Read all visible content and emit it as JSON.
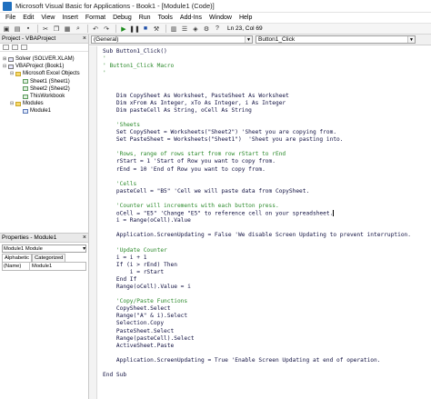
{
  "window": {
    "title": "Microsoft Visual Basic for Applications - Book1 - [Module1 (Code)]"
  },
  "menu": [
    "File",
    "Edit",
    "View",
    "Insert",
    "Format",
    "Debug",
    "Run",
    "Tools",
    "Add-Ins",
    "Window",
    "Help"
  ],
  "toolbar": {
    "status": "Ln 23, Col 69"
  },
  "project_panel": {
    "title": "Project - VBAProject",
    "tree": [
      {
        "label": "Solver (SOLVER.XLAM)",
        "icon": "vba-project-icon",
        "toggle": "+",
        "indent": 0
      },
      {
        "label": "VBAProject (Book1)",
        "icon": "vba-project-icon",
        "toggle": "-",
        "indent": 0
      },
      {
        "label": "Microsoft Excel Objects",
        "icon": "folder-icon",
        "toggle": "-",
        "indent": 1
      },
      {
        "label": "Sheet1 (Sheet1)",
        "icon": "sheet-icon",
        "toggle": "",
        "indent": 2
      },
      {
        "label": "Sheet2 (Sheet2)",
        "icon": "sheet-icon",
        "toggle": "",
        "indent": 2
      },
      {
        "label": "ThisWorkbook",
        "icon": "workbook-icon",
        "toggle": "",
        "indent": 2
      },
      {
        "label": "Modules",
        "icon": "folder-icon",
        "toggle": "-",
        "indent": 1
      },
      {
        "label": "Module1",
        "icon": "module-icon",
        "toggle": "",
        "indent": 2
      }
    ]
  },
  "properties_panel": {
    "title": "Properties - Module1",
    "object_select": "Module1 Module",
    "tabs": [
      "Alphabetic",
      "Categorized"
    ],
    "active_tab": 0,
    "rows": [
      {
        "name": "(Name)",
        "value": "Module1"
      }
    ]
  },
  "code_window": {
    "object_combo": "(General)",
    "procedure_combo": "Button1_Click",
    "lines": [
      {
        "text": "Sub Button1_Click()",
        "kind": "code"
      },
      {
        "text": "'",
        "kind": "comment"
      },
      {
        "text": "' Button1_Click Macro",
        "kind": "comment"
      },
      {
        "text": "'",
        "kind": "comment"
      },
      {
        "text": "",
        "kind": "blank"
      },
      {
        "text": "",
        "kind": "blank"
      },
      {
        "text": "    Dim CopySheet As Worksheet, PasteSheet As Worksheet",
        "kind": "code"
      },
      {
        "text": "    Dim xFrom As Integer, xTo As Integer, i As Integer",
        "kind": "code"
      },
      {
        "text": "    Dim pasteCell As String, oCell As String",
        "kind": "code"
      },
      {
        "text": "",
        "kind": "blank"
      },
      {
        "text": "    'Sheets",
        "kind": "comment"
      },
      {
        "text": "    Set CopySheet = Worksheets(\"Sheet2\") 'Sheet you are copying from.",
        "kind": "code"
      },
      {
        "text": "    Set PasteSheet = Worksheets(\"Sheet1\")  'Sheet you are pasting into.",
        "kind": "code"
      },
      {
        "text": "",
        "kind": "blank"
      },
      {
        "text": "    'Rows, range of rows start from row rStart to rEnd",
        "kind": "comment"
      },
      {
        "text": "    rStart = 1 'Start of Row you want to copy from.",
        "kind": "code"
      },
      {
        "text": "    rEnd = 10 'End of Row you want to copy from.",
        "kind": "code"
      },
      {
        "text": "",
        "kind": "blank"
      },
      {
        "text": "    'Cells",
        "kind": "comment"
      },
      {
        "text": "    pasteCell = \"B5\" 'Cell we will paste data from CopySheet.",
        "kind": "code"
      },
      {
        "text": "",
        "kind": "blank"
      },
      {
        "text": "    'Counter will increments with each button press.",
        "kind": "comment"
      },
      {
        "text": "    oCell = \"E5\" 'Change \"E5\" to reference cell on your spreadsheet.",
        "kind": "code",
        "cursor": true
      },
      {
        "text": "    i = Range(oCell).Value",
        "kind": "code"
      },
      {
        "text": "",
        "kind": "blank"
      },
      {
        "text": "    Application.ScreenUpdating = False 'We disable Screen Updating to prevent interruption.",
        "kind": "code"
      },
      {
        "text": "",
        "kind": "blank"
      },
      {
        "text": "    'Update Counter",
        "kind": "comment"
      },
      {
        "text": "    i = i + 1",
        "kind": "code"
      },
      {
        "text": "    If (i > rEnd) Then",
        "kind": "code"
      },
      {
        "text": "        i = rStart",
        "kind": "code"
      },
      {
        "text": "    End If",
        "kind": "code"
      },
      {
        "text": "    Range(oCell).Value = i",
        "kind": "code"
      },
      {
        "text": "",
        "kind": "blank"
      },
      {
        "text": "    'Copy/Paste Functions",
        "kind": "comment"
      },
      {
        "text": "    CopySheet.Select",
        "kind": "code"
      },
      {
        "text": "    Range(\"A\" & i).Select",
        "kind": "code"
      },
      {
        "text": "    Selection.Copy",
        "kind": "code"
      },
      {
        "text": "    PasteSheet.Select",
        "kind": "code"
      },
      {
        "text": "    Range(pasteCell).Select",
        "kind": "code"
      },
      {
        "text": "    ActiveSheet.Paste",
        "kind": "code"
      },
      {
        "text": "",
        "kind": "blank"
      },
      {
        "text": "    Application.ScreenUpdating = True 'Enable Screen Updating at end of operation.",
        "kind": "code"
      },
      {
        "text": "",
        "kind": "blank"
      },
      {
        "text": "End Sub",
        "kind": "code"
      }
    ]
  }
}
